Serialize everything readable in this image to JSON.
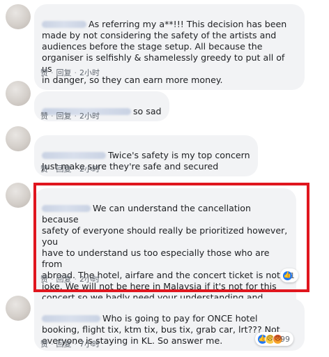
{
  "comments": [
    {
      "text": "As referring my a**!!! This decision has been\nmade by not considering the safety of the artists and\naudiences before the stage setup. All because the\norganiser is selfishly & shamelessly greedy to put all of us\nin danger, so they can earn more money.",
      "like": "赞",
      "reply": "回复",
      "time": "2小时"
    },
    {
      "text": "so sad",
      "like": "赞",
      "reply": "回复",
      "time": "2小时"
    },
    {
      "text": "Twice's safety is my top concern\nJust make sure they're safe and secured",
      "like": "赞",
      "reply": "回复",
      "time": "2小时"
    },
    {
      "text": "We can understand the cancellation because\nsafety of everyone should really be prioritized however, you\nhave to understand us too especially those who are from\nabroad. The hotel, airfare and the concert ticket is not a\njoke. We will not be here in Malaysia if it's not for this\nconcert so we badly need your understanding and\nconsideration too. We need a good refund for this hassle.",
      "like": "赞",
      "reply": "回复",
      "time": "2小时",
      "reaction_count": "1"
    },
    {
      "text": "Who is going to pay for ONCE hotel\nbooking, flight tix, ktm tix, bus tix, grab car, lrt??? Not\neveryone is staying in KL. So answer me.",
      "like": "赞",
      "reply": "回复",
      "time": "7小时",
      "reaction_count": "99"
    }
  ],
  "colors": {
    "bubble": "#f2f3f5",
    "text": "#1c1e21",
    "meta": "#606770",
    "highlight": "#e0161e",
    "like_reaction": "#2078f4"
  },
  "icons": [
    "like-reaction-icon",
    "sad-reaction-icon",
    "angry-reaction-icon"
  ]
}
